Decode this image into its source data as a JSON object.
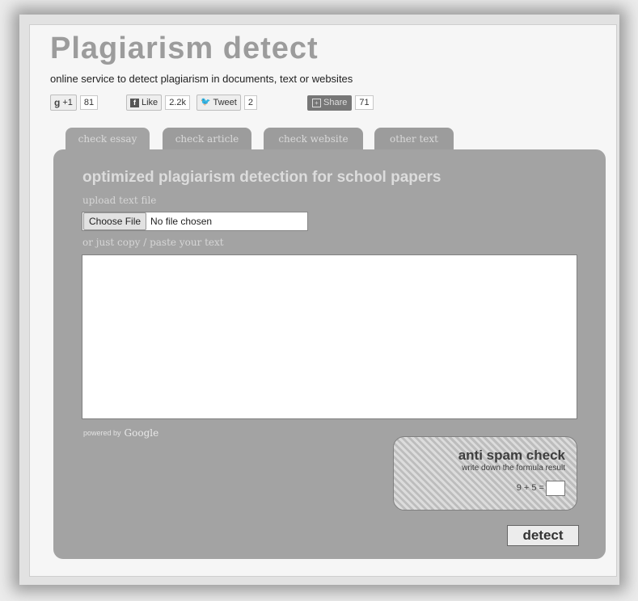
{
  "header": {
    "title": "Plagiarism detect",
    "subtitle": "online service to detect plagiarism in documents, text or websites"
  },
  "social": {
    "gplus": {
      "icon": "google-plus-icon",
      "label": "+1",
      "count": "81"
    },
    "facebook": {
      "icon": "facebook-icon",
      "label": "Like",
      "count": "2.2k"
    },
    "twitter": {
      "icon": "twitter-bird-icon",
      "label": "Tweet",
      "count": "2"
    },
    "share": {
      "icon": "plus-box-icon",
      "label": "Share",
      "count": "71"
    }
  },
  "tabs": [
    {
      "label": "check essay",
      "active": true
    },
    {
      "label": "check article",
      "active": false
    },
    {
      "label": "check website",
      "active": false
    },
    {
      "label": "other text",
      "active": false
    }
  ],
  "panel": {
    "title": "optimized plagiarism detection for school papers",
    "upload_label": "upload text file",
    "choose_file_label": "Choose File",
    "file_status": "No file chosen",
    "paste_label": "or just copy / paste your text",
    "textarea_value": "",
    "powered_by": "powered by",
    "powered_brand": "Google"
  },
  "spam_check": {
    "title": "anti spam check",
    "instruction": "write down the formula result",
    "formula": "9 + 5 =",
    "answer": ""
  },
  "detect_label": "detect",
  "colors": {
    "panel": "#a3a3a3",
    "title": "#9c9c9c",
    "spam_text": "#3e3e3e"
  }
}
